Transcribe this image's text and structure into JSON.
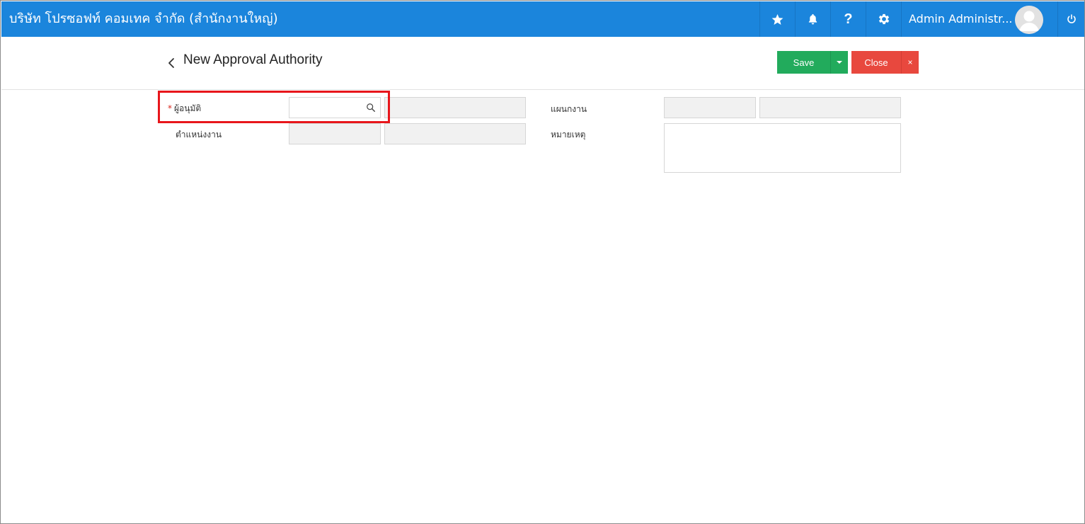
{
  "topbar": {
    "company": "บริษัท โปรซอฟท์ คอมเทค จำกัด (สำนักงานใหญ่)",
    "help_label": "?",
    "user_name": "Admin Administr...",
    "background_color": "#1b85dc"
  },
  "header": {
    "title": "New Approval Authority",
    "save_label": "Save",
    "close_label": "Close",
    "close_x_label": "×",
    "save_color": "#22ab5c",
    "close_color": "#e8483e"
  },
  "form": {
    "approver": {
      "label": "ผู้อนุมัติ",
      "required_mark": "*",
      "value": "",
      "name_value": ""
    },
    "position": {
      "label": "ตำแหน่งงาน",
      "code_value": "",
      "name_value": ""
    },
    "department": {
      "label": "แผนกงาน",
      "code_value": "",
      "name_value": ""
    },
    "remark": {
      "label": "หมายเหตุ",
      "value": ""
    }
  },
  "icons": [
    "star-icon",
    "bell-icon",
    "help-icon",
    "gear-icon",
    "user-avatar-icon",
    "power-icon",
    "back-chevron-icon",
    "search-icon",
    "caret-down-icon"
  ]
}
